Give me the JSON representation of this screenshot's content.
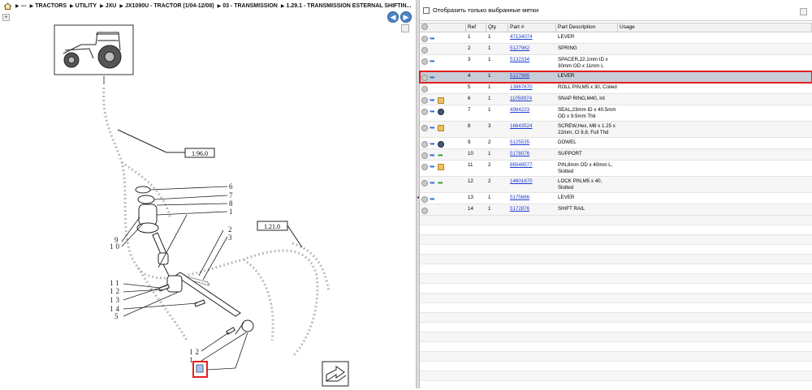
{
  "breadcrumb": {
    "items": [
      "---",
      "TRACTORS",
      "UTILITY",
      "JXU",
      "JX1090U - TRACTOR (1/04-12/08)",
      "03 - TRANSMISSION",
      "1.29.1 - TRANSMISSION ESTERNAL SHIFTIN..."
    ]
  },
  "nav": {
    "back": "◀",
    "forward": "▶"
  },
  "diagram": {
    "refs": [
      "1.96.0",
      "1.21.0"
    ],
    "callouts_right": [
      "6",
      "7",
      "8",
      "1",
      "2",
      "3"
    ],
    "callouts_left": [
      "9",
      "10",
      "11",
      "12",
      "13",
      "14",
      "5",
      "12",
      "1"
    ]
  },
  "filter": {
    "label": "Отобразить только выбранные метки"
  },
  "table": {
    "headers": {
      "ref": "Ref",
      "qty": "Qty",
      "part": "Part #",
      "desc": "Part Description",
      "usage": "Usage"
    },
    "rows": [
      {
        "ref": "1",
        "qty": "1",
        "part": "47134074",
        "desc": "LEVER",
        "icons": [
          "grey",
          "blue"
        ]
      },
      {
        "ref": "2",
        "qty": "1",
        "part": "5127962",
        "desc": "SPRING",
        "icons": [
          "grey"
        ]
      },
      {
        "ref": "3",
        "qty": "1",
        "part": "5132334",
        "desc": "SPACER,22.1mm ID x 30mm OD x 11mm L",
        "icons": [
          "grey",
          "blue"
        ]
      },
      {
        "ref": "4",
        "qty": "1",
        "part": "5127965",
        "desc": "LEVER",
        "icons": [
          "grey",
          "blue"
        ],
        "selected": true
      },
      {
        "ref": "5",
        "qty": "1",
        "part": "13967670",
        "desc": "ROLL PIN,M5 x 30, Coiled",
        "icons": [
          "grey"
        ]
      },
      {
        "ref": "6",
        "qty": "1",
        "part": "11059974",
        "desc": "SNAP RING,M40, Int",
        "icons": [
          "grey",
          "blue",
          "box"
        ]
      },
      {
        "ref": "7",
        "qty": "1",
        "part": "4984223",
        "desc": "SEAL,23mm ID x 40.5mm OD x 9.5mm Thk",
        "icons": [
          "grey",
          "blue",
          "gear"
        ]
      },
      {
        "ref": "8",
        "qty": "3",
        "part": "16643524",
        "desc": "SCREW,Hex, M8 x 1.25 x 22mm, Cl 8.8, Full Thd",
        "icons": [
          "grey",
          "blue",
          "box"
        ]
      },
      {
        "ref": "9",
        "qty": "2",
        "part": "5125535",
        "desc": "DOWEL",
        "icons": [
          "grey",
          "blue",
          "gear"
        ]
      },
      {
        "ref": "10",
        "qty": "1",
        "part": "5178076",
        "desc": "SUPPORT",
        "icons": [
          "grey",
          "blue",
          "green"
        ]
      },
      {
        "ref": "11",
        "qty": "2",
        "part": "86548577",
        "desc": "PIN,8mm OD x 40mm L, Slotted",
        "icons": [
          "grey",
          "blue",
          "box"
        ]
      },
      {
        "ref": "12",
        "qty": "2",
        "part": "14601670",
        "desc": "LOCK PIN,M5 x 40, Slotted",
        "icons": [
          "grey",
          "blue",
          "green"
        ]
      },
      {
        "ref": "13",
        "qty": "1",
        "part": "5175866",
        "desc": "LEVER",
        "icons": [
          "grey",
          "blue"
        ]
      },
      {
        "ref": "14",
        "qty": "1",
        "part": "5172876",
        "desc": "SHIFT RAIL",
        "icons": [
          "grey"
        ]
      }
    ]
  }
}
